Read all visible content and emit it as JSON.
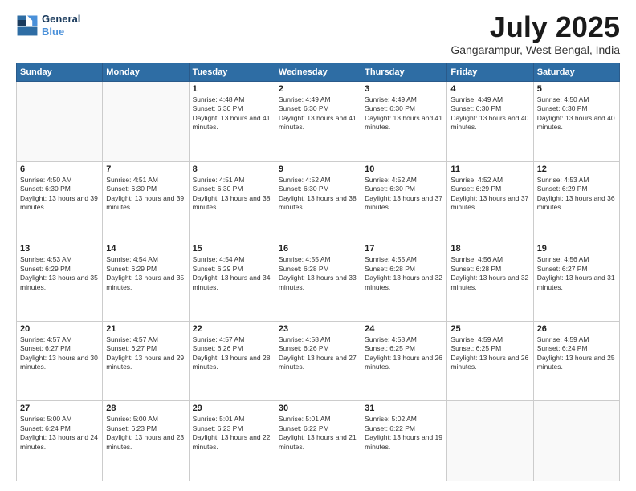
{
  "logo": {
    "line1": "General",
    "line2": "Blue"
  },
  "title": "July 2025",
  "location": "Gangarampur, West Bengal, India",
  "days_of_week": [
    "Sunday",
    "Monday",
    "Tuesday",
    "Wednesday",
    "Thursday",
    "Friday",
    "Saturday"
  ],
  "weeks": [
    [
      {
        "day": "",
        "info": ""
      },
      {
        "day": "",
        "info": ""
      },
      {
        "day": "1",
        "info": "Sunrise: 4:48 AM\nSunset: 6:30 PM\nDaylight: 13 hours and 41 minutes."
      },
      {
        "day": "2",
        "info": "Sunrise: 4:49 AM\nSunset: 6:30 PM\nDaylight: 13 hours and 41 minutes."
      },
      {
        "day": "3",
        "info": "Sunrise: 4:49 AM\nSunset: 6:30 PM\nDaylight: 13 hours and 41 minutes."
      },
      {
        "day": "4",
        "info": "Sunrise: 4:49 AM\nSunset: 6:30 PM\nDaylight: 13 hours and 40 minutes."
      },
      {
        "day": "5",
        "info": "Sunrise: 4:50 AM\nSunset: 6:30 PM\nDaylight: 13 hours and 40 minutes."
      }
    ],
    [
      {
        "day": "6",
        "info": "Sunrise: 4:50 AM\nSunset: 6:30 PM\nDaylight: 13 hours and 39 minutes."
      },
      {
        "day": "7",
        "info": "Sunrise: 4:51 AM\nSunset: 6:30 PM\nDaylight: 13 hours and 39 minutes."
      },
      {
        "day": "8",
        "info": "Sunrise: 4:51 AM\nSunset: 6:30 PM\nDaylight: 13 hours and 38 minutes."
      },
      {
        "day": "9",
        "info": "Sunrise: 4:52 AM\nSunset: 6:30 PM\nDaylight: 13 hours and 38 minutes."
      },
      {
        "day": "10",
        "info": "Sunrise: 4:52 AM\nSunset: 6:30 PM\nDaylight: 13 hours and 37 minutes."
      },
      {
        "day": "11",
        "info": "Sunrise: 4:52 AM\nSunset: 6:29 PM\nDaylight: 13 hours and 37 minutes."
      },
      {
        "day": "12",
        "info": "Sunrise: 4:53 AM\nSunset: 6:29 PM\nDaylight: 13 hours and 36 minutes."
      }
    ],
    [
      {
        "day": "13",
        "info": "Sunrise: 4:53 AM\nSunset: 6:29 PM\nDaylight: 13 hours and 35 minutes."
      },
      {
        "day": "14",
        "info": "Sunrise: 4:54 AM\nSunset: 6:29 PM\nDaylight: 13 hours and 35 minutes."
      },
      {
        "day": "15",
        "info": "Sunrise: 4:54 AM\nSunset: 6:29 PM\nDaylight: 13 hours and 34 minutes."
      },
      {
        "day": "16",
        "info": "Sunrise: 4:55 AM\nSunset: 6:28 PM\nDaylight: 13 hours and 33 minutes."
      },
      {
        "day": "17",
        "info": "Sunrise: 4:55 AM\nSunset: 6:28 PM\nDaylight: 13 hours and 32 minutes."
      },
      {
        "day": "18",
        "info": "Sunrise: 4:56 AM\nSunset: 6:28 PM\nDaylight: 13 hours and 32 minutes."
      },
      {
        "day": "19",
        "info": "Sunrise: 4:56 AM\nSunset: 6:27 PM\nDaylight: 13 hours and 31 minutes."
      }
    ],
    [
      {
        "day": "20",
        "info": "Sunrise: 4:57 AM\nSunset: 6:27 PM\nDaylight: 13 hours and 30 minutes."
      },
      {
        "day": "21",
        "info": "Sunrise: 4:57 AM\nSunset: 6:27 PM\nDaylight: 13 hours and 29 minutes."
      },
      {
        "day": "22",
        "info": "Sunrise: 4:57 AM\nSunset: 6:26 PM\nDaylight: 13 hours and 28 minutes."
      },
      {
        "day": "23",
        "info": "Sunrise: 4:58 AM\nSunset: 6:26 PM\nDaylight: 13 hours and 27 minutes."
      },
      {
        "day": "24",
        "info": "Sunrise: 4:58 AM\nSunset: 6:25 PM\nDaylight: 13 hours and 26 minutes."
      },
      {
        "day": "25",
        "info": "Sunrise: 4:59 AM\nSunset: 6:25 PM\nDaylight: 13 hours and 26 minutes."
      },
      {
        "day": "26",
        "info": "Sunrise: 4:59 AM\nSunset: 6:24 PM\nDaylight: 13 hours and 25 minutes."
      }
    ],
    [
      {
        "day": "27",
        "info": "Sunrise: 5:00 AM\nSunset: 6:24 PM\nDaylight: 13 hours and 24 minutes."
      },
      {
        "day": "28",
        "info": "Sunrise: 5:00 AM\nSunset: 6:23 PM\nDaylight: 13 hours and 23 minutes."
      },
      {
        "day": "29",
        "info": "Sunrise: 5:01 AM\nSunset: 6:23 PM\nDaylight: 13 hours and 22 minutes."
      },
      {
        "day": "30",
        "info": "Sunrise: 5:01 AM\nSunset: 6:22 PM\nDaylight: 13 hours and 21 minutes."
      },
      {
        "day": "31",
        "info": "Sunrise: 5:02 AM\nSunset: 6:22 PM\nDaylight: 13 hours and 19 minutes."
      },
      {
        "day": "",
        "info": ""
      },
      {
        "day": "",
        "info": ""
      }
    ]
  ]
}
